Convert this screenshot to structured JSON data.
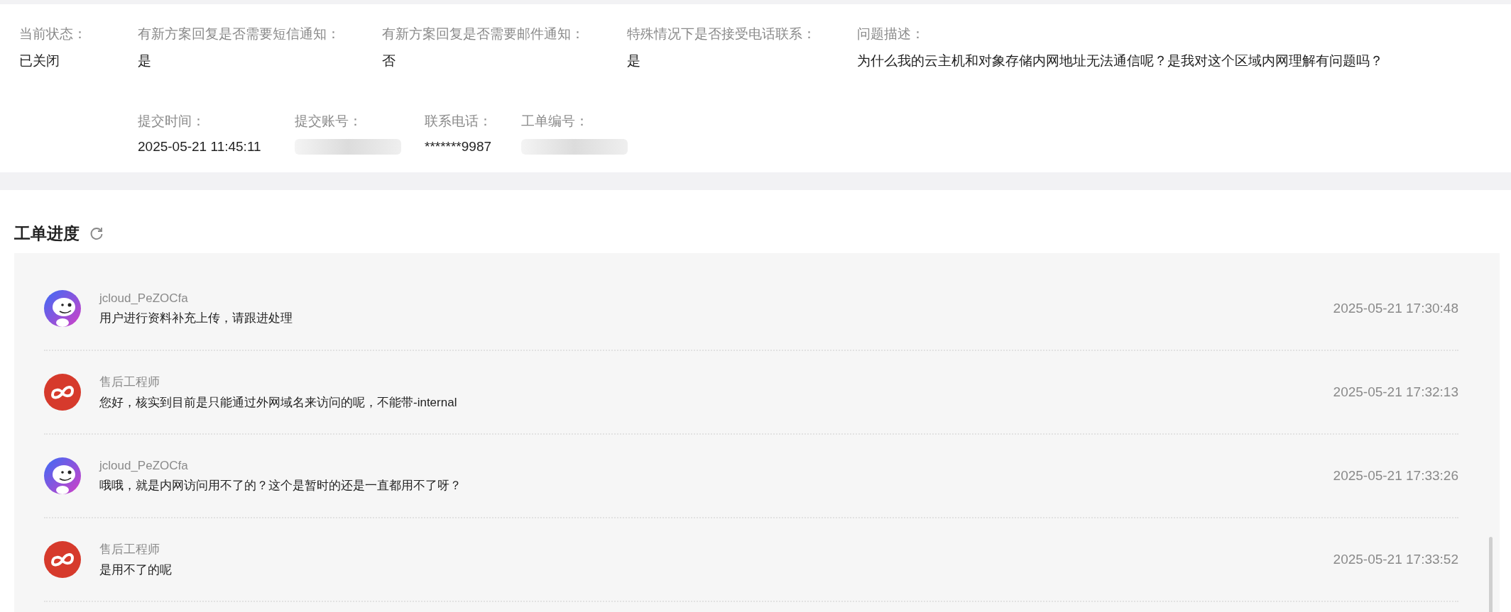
{
  "ticket_info": {
    "fields": [
      {
        "label": "当前状态：",
        "value": "已关闭"
      },
      {
        "label": "有新方案回复是否需要短信通知：",
        "value": "是"
      },
      {
        "label": "有新方案回复是否需要邮件通知：",
        "value": "否"
      },
      {
        "label": "特殊情况下是否接受电话联系：",
        "value": "是"
      },
      {
        "label": "问题描述：",
        "value": "为什么我的云主机和对象存储内网地址无法通信呢？是我对这个区域内网理解有问题吗？"
      }
    ],
    "meta_fields": [
      {
        "label": "提交时间：",
        "value": "2025-05-21 11:45:11",
        "redacted": false
      },
      {
        "label": "提交账号：",
        "redacted": true
      },
      {
        "label": "联系电话：",
        "value": "*******9987",
        "redacted": false
      },
      {
        "label": "工单编号：",
        "redacted": true
      }
    ]
  },
  "progress": {
    "title": "工单进度",
    "entries": [
      {
        "author": "jcloud_PeZOCfa",
        "kind": "user",
        "message": "用户进行资料补充上传，请跟进处理",
        "time": "2025-05-21 17:30:48"
      },
      {
        "author": "售后工程师",
        "kind": "engineer",
        "message": "您好，核实到目前是只能通过外网域名来访问的呢，不能带-internal",
        "time": "2025-05-21 17:32:13"
      },
      {
        "author": "jcloud_PeZOCfa",
        "kind": "user",
        "message": "哦哦，就是内网访问用不了的？这个是暂时的还是一直都用不了呀？",
        "time": "2025-05-21 17:33:26"
      },
      {
        "author": "售后工程师",
        "kind": "engineer",
        "message": "是用不了的呢",
        "time": "2025-05-21 17:33:52"
      }
    ]
  }
}
